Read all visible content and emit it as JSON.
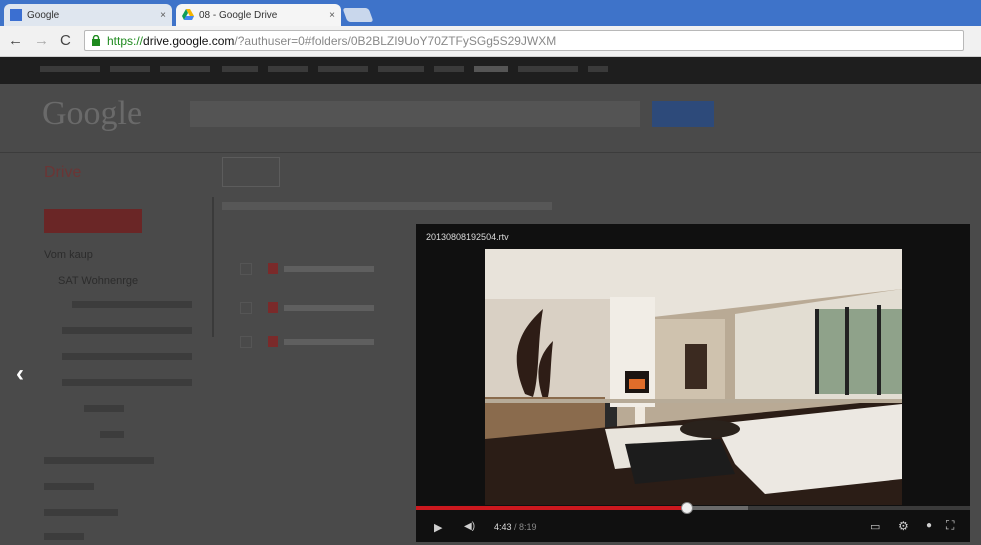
{
  "browser": {
    "tabs": [
      {
        "title": "Google",
        "active": false,
        "icon": "google-favicon"
      },
      {
        "title": "08 - Google Drive",
        "active": true,
        "icon": "drive-favicon"
      }
    ],
    "close_glyph": "×",
    "url": {
      "scheme": "https://",
      "host": "drive.google.com",
      "path": "/?authuser=0#folders/0B2BLZI9UoY70ZTFySGg5S29JWXM"
    }
  },
  "drive": {
    "logo": "Google",
    "app_title": "Drive",
    "tree": [
      "Vom kaup",
      "SAT Wohnenrge"
    ]
  },
  "viewer": {
    "filename": "20130808192504.rtv",
    "current_time": "4:43",
    "duration": "/ 8:19",
    "played_fraction": 0.49,
    "buffered_fraction": 0.6
  },
  "icons": {
    "prev": "‹",
    "play": "▶",
    "volume": "◀)",
    "captions": "▭",
    "settings": "⚙",
    "quality": "●",
    "fullscreen": "⛶"
  },
  "colors": {
    "chrome_blue": "#3e73c9",
    "https_green": "#1e8a1e",
    "progress_red": "#cc181e"
  }
}
